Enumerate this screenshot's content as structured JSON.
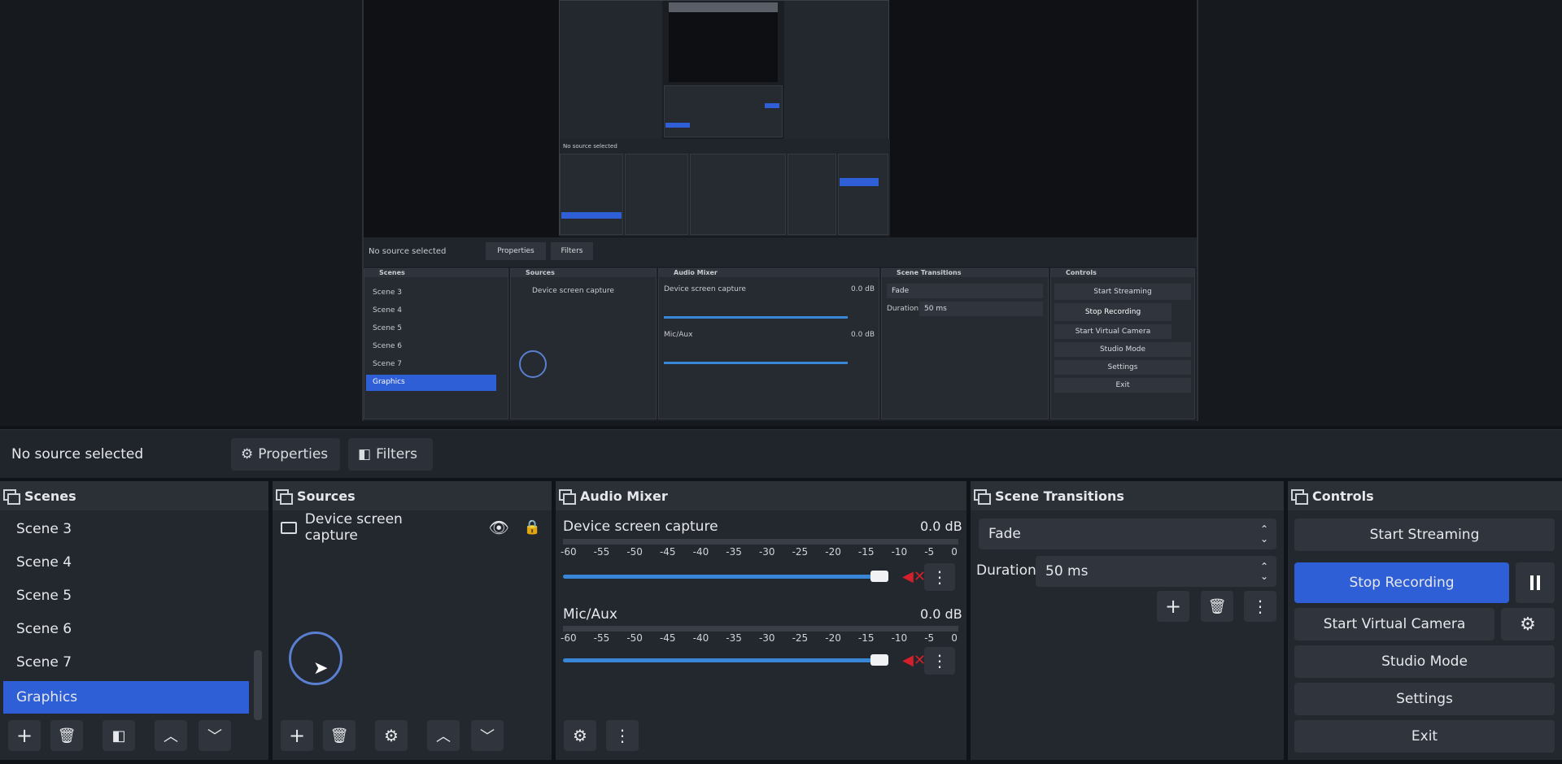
{
  "props_bar": {
    "no_source": "No source selected",
    "properties_label": "Properties",
    "filters_label": "Filters"
  },
  "scenes": {
    "title": "Scenes",
    "items": [
      "Scene 3",
      "Scene 4",
      "Scene 5",
      "Scene 6",
      "Scene 7",
      "Graphics"
    ],
    "selected": "Graphics"
  },
  "sources": {
    "title": "Sources",
    "items": [
      {
        "label": "Device screen capture"
      }
    ]
  },
  "mixer": {
    "title": "Audio Mixer",
    "ticks": [
      "-60",
      "-55",
      "-50",
      "-45",
      "-40",
      "-35",
      "-30",
      "-25",
      "-20",
      "-15",
      "-10",
      "-5",
      "0"
    ],
    "channels": [
      {
        "name": "Device screen capture",
        "level": "0.0 dB",
        "volume": 0.96
      },
      {
        "name": "Mic/Aux",
        "level": "0.0 dB",
        "volume": 0.96
      }
    ]
  },
  "transitions": {
    "title": "Scene Transitions",
    "selected": "Fade",
    "duration_label": "Duration",
    "duration_value": "50 ms"
  },
  "controls": {
    "title": "Controls",
    "start_streaming": "Start Streaming",
    "stop_recording": "Stop Recording",
    "start_virtual_camera": "Start Virtual Camera",
    "studio_mode": "Studio Mode",
    "settings": "Settings",
    "exit": "Exit"
  },
  "preview_nested": {
    "no_source": "No source selected",
    "properties_label": "Properties",
    "filters_label": "Filters",
    "scenes_title": "Scenes",
    "sources_title": "Sources",
    "mixer_title": "Audio Mixer",
    "transitions_title": "Scene Transitions",
    "controls_title": "Controls",
    "scene_items": [
      "Scene 3",
      "Scene 4",
      "Scene 5",
      "Scene 6",
      "Scene 7",
      "Graphics"
    ],
    "source_item": "Device screen capture",
    "ch1": "Device screen capture",
    "ch2": "Mic/Aux",
    "db": "0.0 dB",
    "fade": "Fade",
    "duration_label": "Duration",
    "duration_value": "50 ms",
    "start_streaming": "Start Streaming",
    "stop_recording": "Stop Recording",
    "start_virtual_camera": "Start Virtual Camera",
    "studio_mode": "Studio Mode",
    "settings": "Settings",
    "exit": "Exit"
  },
  "icons": {
    "add": "plus-icon",
    "remove": "trash-icon",
    "filter": "filter-icon",
    "up": "chevron-up-icon",
    "down": "chevron-down-icon",
    "gear": "gear-icon",
    "eye": "eye-icon",
    "lock": "lock-icon",
    "pause": "pause-icon",
    "mute": "speaker-muted-icon",
    "menu": "kebab-menu-icon"
  },
  "colors": {
    "accent": "#2f5fd6",
    "meter": "#3a86d6",
    "mute": "#d3202a"
  }
}
